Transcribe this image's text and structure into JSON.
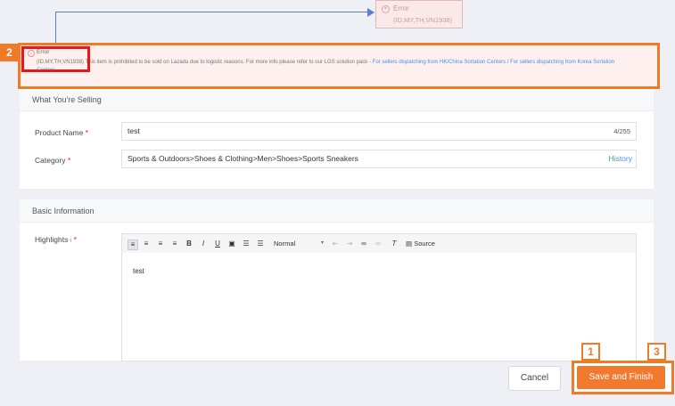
{
  "callout": {
    "title": "Error",
    "countries": "(ID,MY,TH,VN1938)"
  },
  "error_banner": {
    "title": "Error",
    "countries": "(ID,MY,TH,VN1938)",
    "message": "This item is prohibited to be sold on Lazada due to logistic reasons. For more info please refer to our LGS solution pack -",
    "link1": "For sellers dispatching from HK/China Sortation Centers",
    "separator": "/",
    "link2_part1": "For sellers dispatching from Korea Sortation",
    "link2_part2": "Centers"
  },
  "badges": {
    "b1": "1",
    "b2": "2",
    "b3": "3"
  },
  "selling": {
    "section_title": "What You're Selling",
    "product_name_label": "Product Name",
    "product_name_value": "test",
    "product_name_count": "4/255",
    "category_label": "Category",
    "category_value": "Sports & Outdoors>Shoes & Clothing>Men>Shoes>Sports Sneakers",
    "history_label": "History",
    "required_mark": "*"
  },
  "basic": {
    "section_title": "Basic Information",
    "highlights_label": "Highlights",
    "info_mark": "i",
    "required_mark": "*",
    "editor_text": "test",
    "format_select": "Normal",
    "source_label": "Source"
  },
  "footer": {
    "cancel_label": "Cancel",
    "save_label": "Save and Finish"
  },
  "colors": {
    "accent": "#f27a2f",
    "link": "#4d8ee8",
    "annotation_orange": "#f07a25",
    "annotation_red": "#e01b1b"
  }
}
